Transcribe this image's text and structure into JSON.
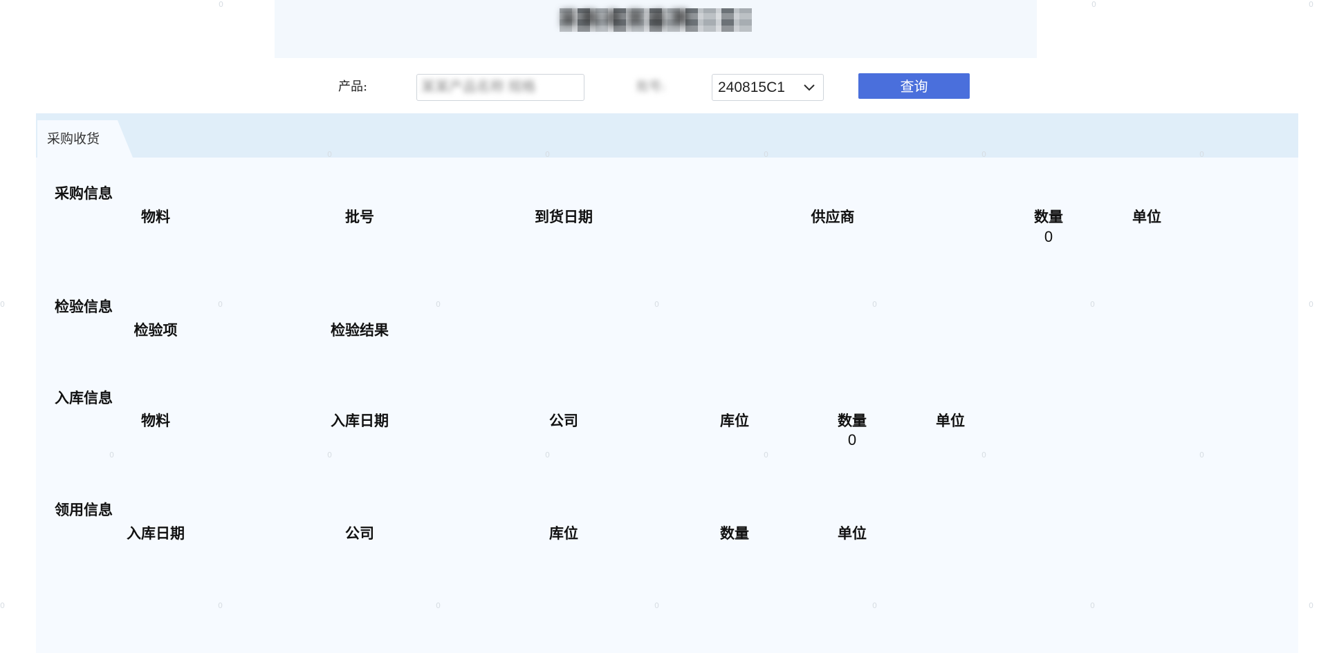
{
  "header": {
    "title": "采购收货追溯",
    "watermark_char": "0"
  },
  "filters": {
    "product_label": "产品:",
    "product_value": "某某产品名称 规格",
    "batch_label": "批号:",
    "batch_value": "240815C1",
    "query_button": "查询"
  },
  "tabs": [
    {
      "label": "采购收货",
      "active": true
    }
  ],
  "purchase_info": {
    "title": "采购信息",
    "columns": [
      "物料",
      "批号",
      "到货日期",
      "供应商",
      "数量",
      "单位"
    ],
    "row": {
      "quantity": "0"
    }
  },
  "inspection_info": {
    "title": "检验信息",
    "columns": [
      "检验项",
      "检验结果"
    ]
  },
  "warehousing_info": {
    "title": "入库信息",
    "columns": [
      "物料",
      "入库日期",
      "公司",
      "库位",
      "数量",
      "单位"
    ],
    "row": {
      "quantity": "0"
    }
  },
  "requisition_info": {
    "title": "领用信息",
    "columns": [
      "入库日期",
      "公司",
      "库位",
      "数量",
      "单位"
    ]
  },
  "colors": {
    "primary_button": "#4a6fdc",
    "panel_bg": "#f6faff",
    "tab_strip_bg": "#e0eef9",
    "title_area_bg": "#f3f8fd"
  }
}
